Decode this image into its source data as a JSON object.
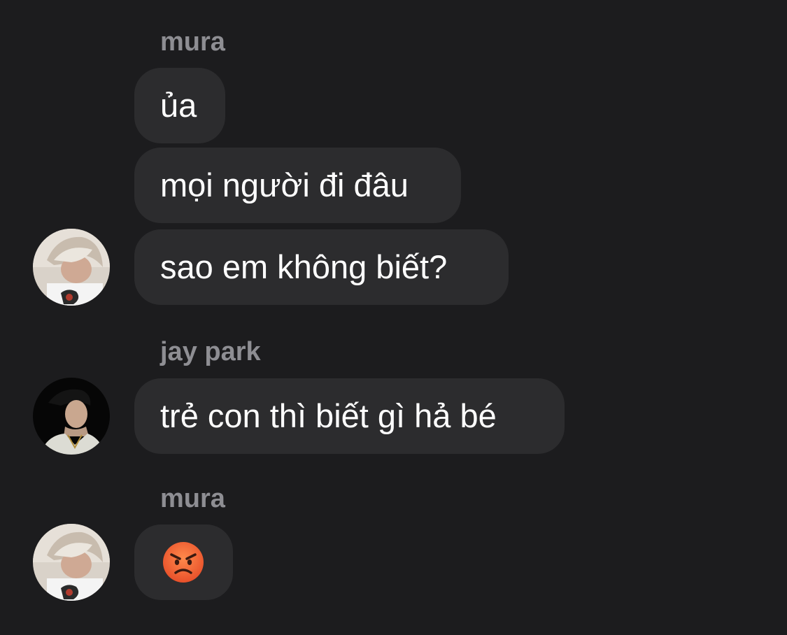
{
  "chat": {
    "groups": [
      {
        "sender": "mura",
        "avatar": "mura-avatar",
        "messages": [
          "ủa",
          "mọi người đi đâu",
          "sao em không biết?"
        ]
      },
      {
        "sender": "jay park",
        "avatar": "jay-park-avatar",
        "messages": [
          "trẻ con thì biết gì hả bé"
        ]
      },
      {
        "sender": "mura",
        "avatar": "mura-avatar",
        "messages": [
          "angry-face-emoji"
        ]
      }
    ]
  },
  "colors": {
    "background": "#1c1c1e",
    "bubble": "#2c2c2e",
    "sender_name": "#8e8e93",
    "message_text": "#ffffff",
    "emoji_face": "#f2652c"
  }
}
